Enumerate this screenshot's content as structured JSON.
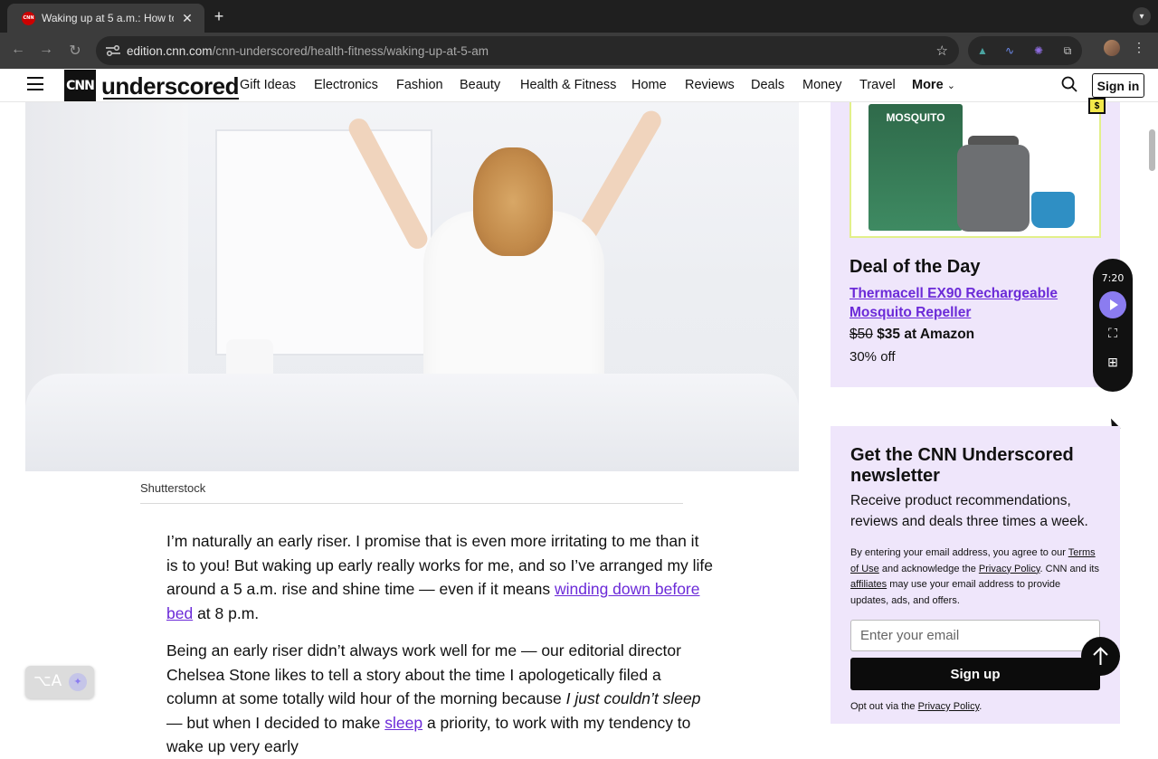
{
  "browser": {
    "tab_title": "Waking up at 5 a.m.: How to h",
    "tab_favicon": "CNN",
    "tab_close": "✕",
    "new_tab": "+",
    "url_host": "edition.cnn.com",
    "url_path": "/cnn-underscored/health-fitness/waking-up-at-5-am",
    "accent": "#3c3c3c"
  },
  "site": {
    "logo_text": "CNN",
    "brand": "underscored",
    "nav": [
      "Gift Ideas",
      "Electronics",
      "Fashion",
      "Beauty",
      "Health & Fitness",
      "Home",
      "Reviews",
      "Deals",
      "Money",
      "Travel"
    ],
    "more_label": "More",
    "sign_in": "Sign in"
  },
  "article": {
    "image_credit": "Shutterstock",
    "p1_before": "I’m naturally an early riser. I promise that is even more irritating to me than it is to you! But waking up early really works for me, and so I’ve arranged my life around a 5 a.m. rise and shine time — even if it means ",
    "p1_link": "winding down before bed",
    "p1_after": " at 8 p.m.",
    "p2_before": "Being an early riser didn’t always work well for me — our editorial director Chelsea Stone likes to tell a story about the time I apologetically filed a column at some totally wild hour of the morning because ",
    "p2_em": "I just couldn’t sleep",
    "p2_mid": " — but when I decided to make ",
    "p2_link": "sleep",
    "p2_after": " a priority, to work with my tendency to wake up very early"
  },
  "deal": {
    "badge": "$",
    "product_pack_text": "MOSQUITO",
    "heading": "Deal of the Day",
    "product": "Thermacell EX90 Rechargeable Mosquito Repeller",
    "old_price": "$50",
    "new_price": "$35 at Amazon",
    "discount": "30% off"
  },
  "player": {
    "time": "7:20"
  },
  "newsletter": {
    "title": "Get the CNN Underscored newsletter",
    "subtitle": "Receive product recommendations, reviews and deals three times a week.",
    "legal_1": "By entering your email address, you agree to our ",
    "terms_link": "Terms of Use",
    "legal_2": " and acknowledge the ",
    "privacy_link": "Privacy Policy",
    "legal_3": ". CNN and its ",
    "affiliates_link": "affiliates",
    "legal_4": " may use your email address to provide updates, ads, and offers.",
    "email_placeholder": "Enter your email",
    "signup": "Sign up",
    "optout_before": "Opt out via the ",
    "optout_link": "Privacy Policy",
    "optout_after": "."
  },
  "ime": {
    "label": "⌥A"
  }
}
